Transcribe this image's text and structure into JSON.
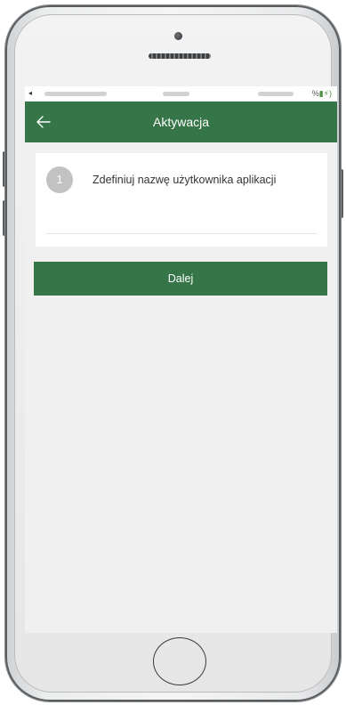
{
  "statusbar": {
    "left_glyph": "◂",
    "right_text": "%",
    "battery_glyph": "▮⚡)"
  },
  "appbar": {
    "title": "Aktywacja",
    "back_icon": "arrow-left-icon"
  },
  "step": {
    "number": "1",
    "text": "Zdefiniuj nazwę użytkownika aplikacji"
  },
  "actions": {
    "next_label": "Dalej"
  },
  "colors": {
    "brand_green": "#357548",
    "screen_bg": "#f0f0f0",
    "step_circle": "#c2c2c2"
  }
}
